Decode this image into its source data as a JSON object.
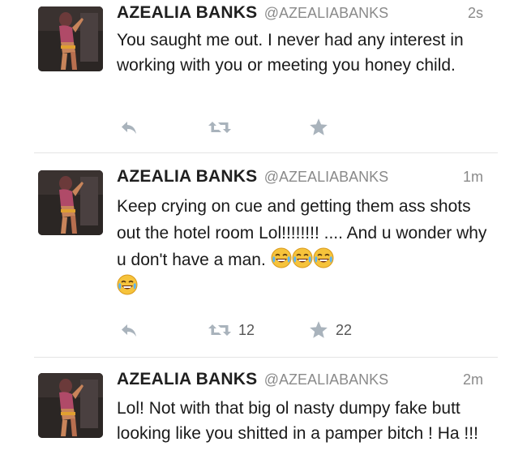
{
  "tweets": [
    {
      "name": "AZEALIA BANKS",
      "handle": "@AZEALIABANKS",
      "time": "2s",
      "text": "You saught me out. I never had any interest in working with you or meeting you honey child.",
      "retweets": "",
      "favorites": "",
      "icons": [
        "reply-icon",
        "retweet-icon",
        "favorite-icon"
      ]
    },
    {
      "name": "AZEALIA BANKS",
      "handle": "@AZEALIABANKS",
      "time": "1m",
      "text": "Keep crying on cue and getting them ass shots out the hotel room Lol!!!!!!!! .... And u wonder why u don't have a man.",
      "emoji": "😂😂😂😂",
      "retweets": "12",
      "favorites": "22",
      "icons": [
        "reply-icon",
        "retweet-icon",
        "favorite-icon"
      ]
    },
    {
      "name": "AZEALIA BANKS",
      "handle": "@AZEALIABANKS",
      "time": "2m",
      "text": "Lol! Not with that big ol nasty dumpy fake butt looking like you shitted in a pamper bitch ! Ha !!!",
      "icons": [
        "reply-icon",
        "retweet-icon",
        "favorite-icon"
      ]
    }
  ],
  "colors": {
    "action_icon": "#a9b3bc",
    "handle_gray": "#8a8a8a",
    "divider": "#e4e4e4"
  }
}
